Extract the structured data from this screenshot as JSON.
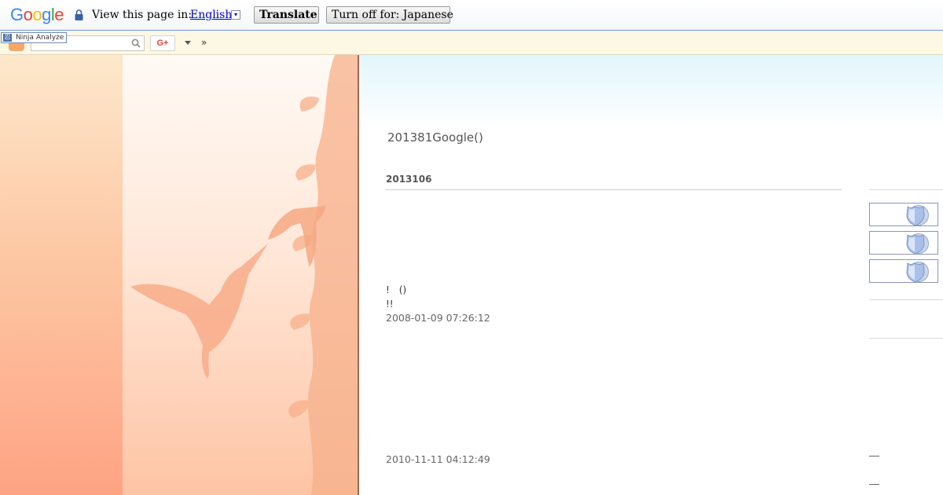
{
  "translate_bar": {
    "logo": {
      "g": "G",
      "o1": "o",
      "o2": "o",
      "g2": "g",
      "l": "l",
      "e": "e"
    },
    "prompt": "View this page in:",
    "language": "English",
    "dropdown_glyph": "▾",
    "translate_label": "Translate",
    "turn_off_label": "Turn off for: Japanese"
  },
  "toolbar": {
    "tooltip": "Ninja Analyze",
    "ninja_glyph": "忍",
    "search_placeholder": "",
    "gplus_label": "G+",
    "more_label": "»"
  },
  "blog": {
    "title": "201381Google()",
    "date_heading": "2013106",
    "entries": [
      {
        "line1": "!　()",
        "line2": "!!",
        "timestamp": "2008-01-09 07:26:12"
      },
      {
        "timestamp": "2010-11-11 04:12:49"
      }
    ]
  },
  "colors": {
    "translate_border": "#6b90da",
    "toolbar_bg": "#fdf8e4",
    "left_strip": "#fea384",
    "left_art": "#fec4a4",
    "main_top": "#e2f6fb"
  },
  "icons": [
    "lock-icon",
    "ninja-icon",
    "search-icon",
    "gplus-icon",
    "dropdown-arrow-icon",
    "shield-icon"
  ]
}
